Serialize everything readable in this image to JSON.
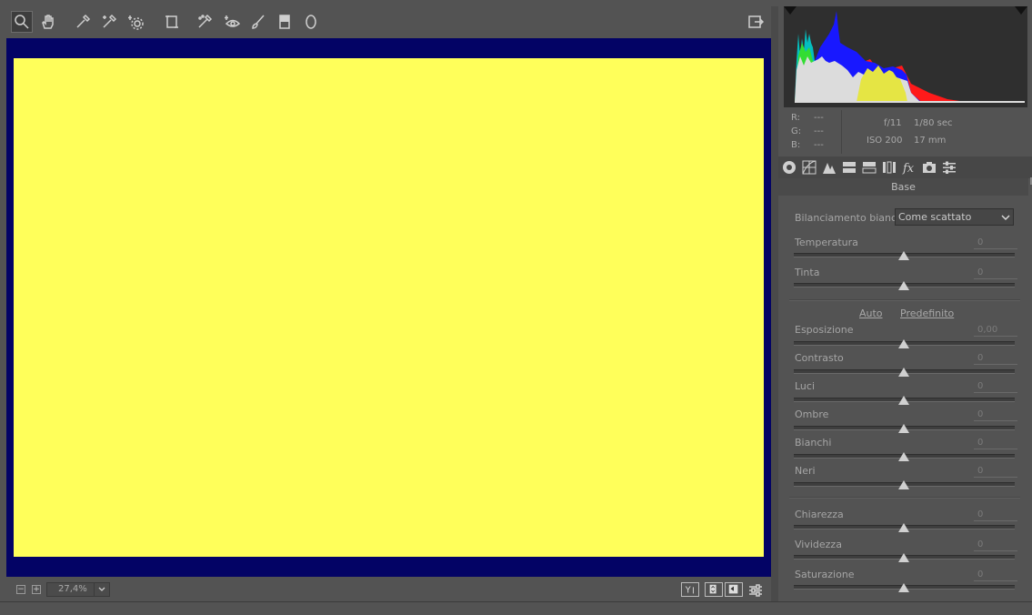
{
  "toolbar": {
    "tools": [
      "zoom-tool",
      "hand-tool",
      "white-balance-tool",
      "color-sampler-tool",
      "targeted-adjustment-tool",
      "transform-tool",
      "spot-removal-tool",
      "red-eye-tool",
      "adjustment-brush",
      "graduated-filter",
      "radial-filter"
    ],
    "active_tool": "zoom-tool"
  },
  "canvas": {
    "background_color": "#030365",
    "photo_color": "#ffff5a"
  },
  "bottombar": {
    "zoom_minus": "−",
    "zoom_plus": "+",
    "zoom_value": "27,4%"
  },
  "info": {
    "r_label": "R:",
    "r_value": "---",
    "g_label": "G:",
    "g_value": "---",
    "b_label": "B:",
    "b_value": "---",
    "aperture": "f/11",
    "shutter": "1/80 sec",
    "iso": "ISO 200",
    "focal": "17 mm"
  },
  "panel": {
    "section_title": "Base",
    "wb_label": "Bilanciamento bianco:",
    "wb_value": "Come scattato",
    "auto_link": "Auto",
    "default_link": "Predefinito",
    "sliders": {
      "temperatura": {
        "label": "Temperatura",
        "value": "0"
      },
      "tinta": {
        "label": "Tinta",
        "value": "0"
      },
      "esposizione": {
        "label": "Esposizione",
        "value": "0,00"
      },
      "contrasto": {
        "label": "Contrasto",
        "value": "0"
      },
      "luci": {
        "label": "Luci",
        "value": "0"
      },
      "ombre": {
        "label": "Ombre",
        "value": "0"
      },
      "bianchi": {
        "label": "Bianchi",
        "value": "0"
      },
      "neri": {
        "label": "Neri",
        "value": "0"
      },
      "chiarezza": {
        "label": "Chiarezza",
        "value": "0"
      },
      "vividezza": {
        "label": "Vividezza",
        "value": "0"
      },
      "saturazione": {
        "label": "Saturazione",
        "value": "0"
      }
    }
  }
}
